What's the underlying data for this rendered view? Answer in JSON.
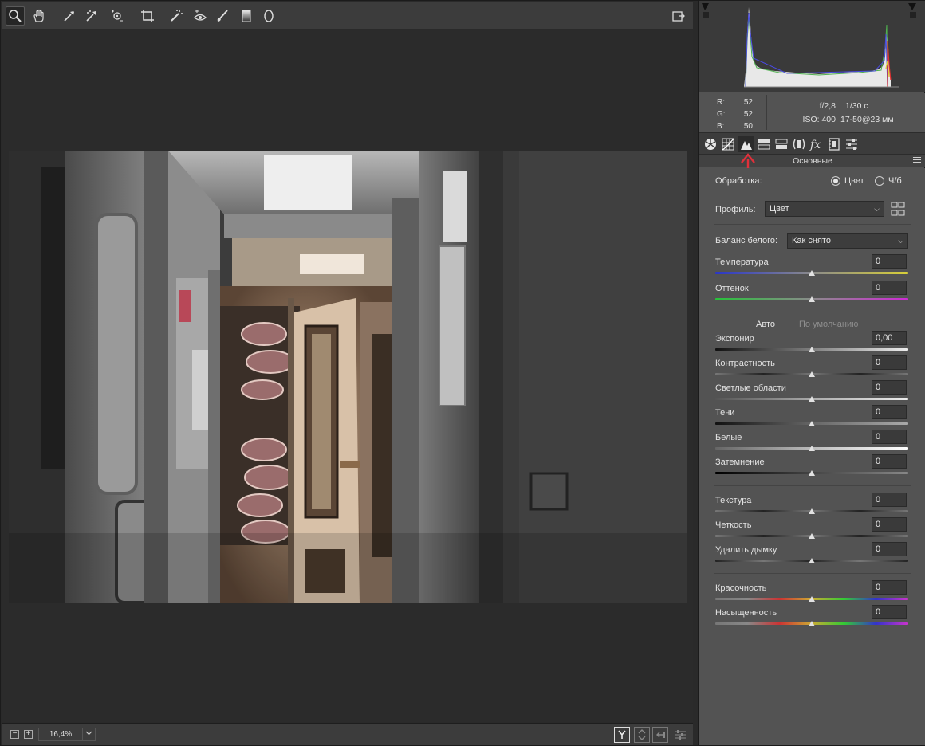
{
  "toolbar": {
    "tools": [
      "zoom-icon",
      "hand-icon",
      "white-balance-icon",
      "color-sampler-icon",
      "targeted-adjustment-icon",
      "crop-icon",
      "spot-removal-icon",
      "red-eye-icon",
      "adjustment-brush-icon",
      "graduated-filter-icon",
      "radial-filter-icon"
    ],
    "open_button": "open-object-icon"
  },
  "bottom": {
    "zoom_out": "−",
    "zoom_in": "+",
    "zoom_level": "16,4%"
  },
  "info": {
    "r_label": "R:",
    "g_label": "G:",
    "b_label": "B:",
    "r": "52",
    "g": "52",
    "b": "50",
    "aperture": "f/2,8",
    "shutter": "1/30 с",
    "iso": "ISO: 400",
    "lens": "17-50@23 мм"
  },
  "panel_tabs": [
    "basic-icon",
    "tone-curve-icon",
    "detail-icon",
    "hsl-icon",
    "split-toning-icon",
    "lens-corrections-icon",
    "effects-icon",
    "camera-calibration-icon",
    "presets-icon"
  ],
  "section": {
    "title": "Основные"
  },
  "basic": {
    "treatment_label": "Обработка:",
    "color_option": "Цвет",
    "bw_option": "Ч/б",
    "profile_label": "Профиль:",
    "profile_value": "Цвет",
    "wb_label": "Баланс белого:",
    "wb_value": "Как снято",
    "temperature_label": "Температура",
    "temperature": "0",
    "tint_label": "Оттенок",
    "tint": "0",
    "auto": "Авто",
    "default": "По умолчанию",
    "exposure_label": "Экспонир",
    "exposure": "0,00",
    "contrast_label": "Контрастность",
    "contrast": "0",
    "highlights_label": "Светлые области",
    "highlights": "0",
    "shadows_label": "Тени",
    "shadows": "0",
    "whites_label": "Белые",
    "whites": "0",
    "blacks_label": "Затемнение",
    "blacks": "0",
    "texture_label": "Текстура",
    "texture": "0",
    "clarity_label": "Четкость",
    "clarity": "0",
    "dehaze_label": "Удалить дымку",
    "dehaze": "0",
    "vibrance_label": "Красочность",
    "vibrance": "0",
    "saturation_label": "Насыщенность",
    "saturation": "0"
  },
  "colors": {
    "panel": "#535353",
    "canvas": "#2b2b2b",
    "accent_arrow": "#e0303a"
  }
}
